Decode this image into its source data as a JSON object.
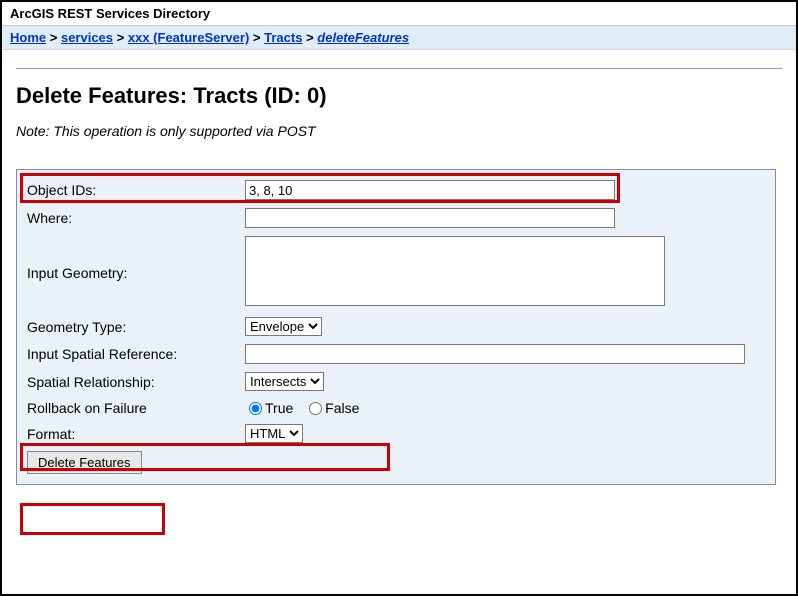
{
  "header_title": "ArcGIS REST Services Directory",
  "breadcrumb": {
    "items": [
      {
        "label": "Home"
      },
      {
        "label": "services"
      },
      {
        "label": "xxx (FeatureServer)"
      },
      {
        "label": "Tracts"
      },
      {
        "label": "deleteFeatures",
        "current": true
      }
    ],
    "sep": " > "
  },
  "page_title": "Delete Features: Tracts (ID: 0)",
  "note": "Note: This operation is only supported via POST",
  "form": {
    "object_ids": {
      "label": "Object IDs:",
      "value": "3, 8, 10"
    },
    "where": {
      "label": "Where:",
      "value": ""
    },
    "input_geometry": {
      "label": "Input Geometry:",
      "value": ""
    },
    "geometry_type": {
      "label": "Geometry Type:",
      "selected": "Envelope"
    },
    "input_sr": {
      "label": "Input Spatial Reference:",
      "value": ""
    },
    "spatial_rel": {
      "label": "Spatial Relationship:",
      "selected": "Intersects"
    },
    "rollback": {
      "label": "Rollback on Failure",
      "true_label": "True",
      "false_label": "False",
      "value": "true"
    },
    "format": {
      "label": "Format:",
      "selected": "HTML"
    },
    "submit_label": "Delete Features"
  }
}
